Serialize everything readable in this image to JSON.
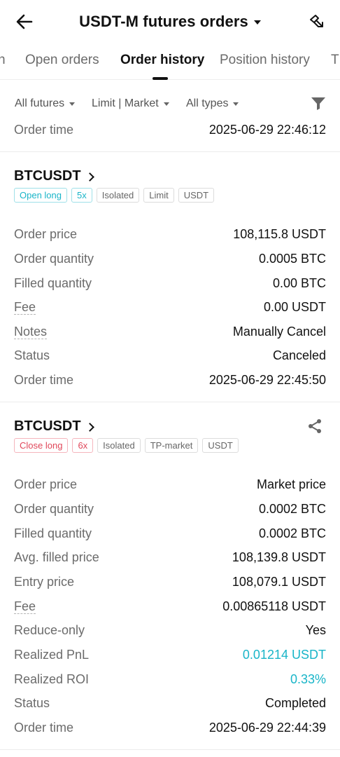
{
  "header": {
    "title": "USDT-M futures orders",
    "back_icon": "arrow-left-icon",
    "share_icon": "share-icon"
  },
  "tabs": [
    {
      "label": "n"
    },
    {
      "label": "Open orders"
    },
    {
      "label": "Order history",
      "active": true
    },
    {
      "label": "Position history"
    },
    {
      "label": "T"
    }
  ],
  "filters": {
    "futures": "All futures",
    "order_type": "Limit | Market",
    "types": "All types",
    "filter_icon": "funnel-icon"
  },
  "top_row": {
    "label": "Order time",
    "value": "2025-06-29 22:46:12"
  },
  "orders": [
    {
      "symbol": "BTCUSDT",
      "tags": [
        {
          "text": "Open long",
          "tone": "teal"
        },
        {
          "text": "5x",
          "tone": "teal"
        },
        {
          "text": "Isolated",
          "tone": "grey"
        },
        {
          "text": "Limit",
          "tone": "grey"
        },
        {
          "text": "USDT",
          "tone": "grey"
        }
      ],
      "rows": [
        {
          "label": "Order price",
          "value": "108,115.8 USDT"
        },
        {
          "label": "Order quantity",
          "value": "0.0005 BTC"
        },
        {
          "label": "Filled quantity",
          "value": "0.00 BTC"
        },
        {
          "label": "Fee",
          "value": "0.00 USDT",
          "dotted": true
        },
        {
          "label": "Notes",
          "value": "Manually Cancel",
          "dotted": true
        },
        {
          "label": "Status",
          "value": "Canceled"
        },
        {
          "label": "Order time",
          "value": "2025-06-29 22:45:50"
        }
      ]
    },
    {
      "symbol": "BTCUSDT",
      "share": true,
      "tags": [
        {
          "text": "Close long",
          "tone": "red"
        },
        {
          "text": "6x",
          "tone": "red"
        },
        {
          "text": "Isolated",
          "tone": "grey"
        },
        {
          "text": "TP-market",
          "tone": "grey"
        },
        {
          "text": "USDT",
          "tone": "grey"
        }
      ],
      "rows": [
        {
          "label": "Order price",
          "value": "Market price"
        },
        {
          "label": "Order quantity",
          "value": "0.0002 BTC"
        },
        {
          "label": "Filled quantity",
          "value": "0.0002 BTC"
        },
        {
          "label": "Avg. filled price",
          "value": "108,139.8 USDT"
        },
        {
          "label": "Entry price",
          "value": "108,079.1 USDT"
        },
        {
          "label": "Fee",
          "value": "0.00865118 USDT",
          "dotted": true
        },
        {
          "label": "Reduce-only",
          "value": "Yes"
        },
        {
          "label": "Realized PnL",
          "value": "0.01214 USDT",
          "tone": "teal"
        },
        {
          "label": "Realized ROI",
          "value": "0.33%",
          "tone": "teal"
        },
        {
          "label": "Status",
          "value": "Completed"
        },
        {
          "label": "Order time",
          "value": "2025-06-29 22:44:39"
        }
      ]
    }
  ],
  "colors": {
    "teal": "#19b5c8",
    "red": "#e0475a",
    "text": "#111111",
    "muted": "#6b6b6b"
  }
}
